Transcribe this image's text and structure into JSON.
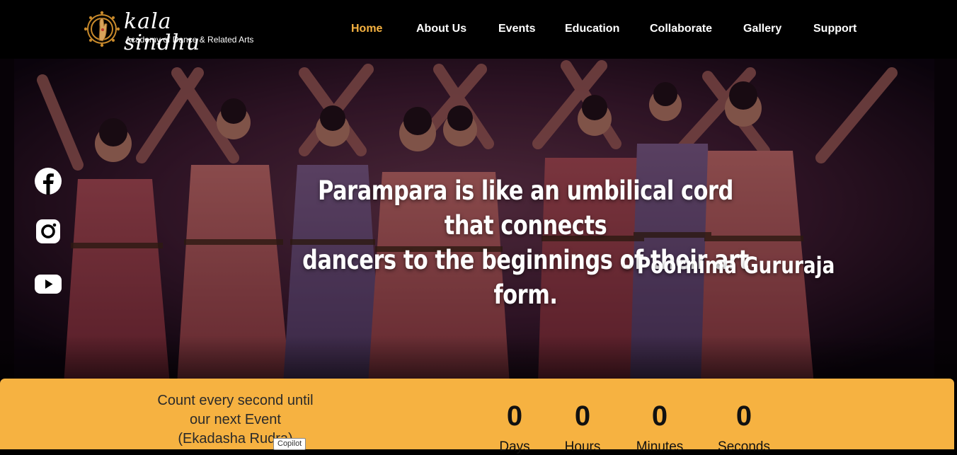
{
  "brand": {
    "title": "kala sindhu",
    "subtitle": "Academy of Dance & Related Arts",
    "logo_icon": "hand-mudra-sun-logo"
  },
  "nav": {
    "items": [
      {
        "label": "Home",
        "active": true
      },
      {
        "label": "About Us"
      },
      {
        "label": "Events"
      },
      {
        "label": "Education"
      },
      {
        "label": "Collaborate"
      },
      {
        "label": "Gallery"
      },
      {
        "label": "Support"
      }
    ]
  },
  "hero": {
    "quote_line1": "Parampara is like an umbilical cord that connects",
    "quote_line2": "dancers to the beginnings of their art form.",
    "author": "- Poornima Gururaja"
  },
  "social": [
    {
      "icon": "facebook-icon"
    },
    {
      "icon": "instagram-icon"
    },
    {
      "icon": "youtube-icon"
    }
  ],
  "countdown": {
    "caption_line1": "Count every second until",
    "caption_line2": "our next Event",
    "caption_line3": "(Ekadasha Rudra)",
    "units": [
      {
        "value": "0",
        "label": "Days"
      },
      {
        "value": "0",
        "label": "Hours"
      },
      {
        "value": "0",
        "label": "Minutes"
      },
      {
        "value": "0",
        "label": "Seconds"
      }
    ]
  },
  "tooltip": "Copilot",
  "colors": {
    "accent": "#f6b241",
    "nav_bg": "#000000",
    "text_light": "#ffffff"
  }
}
